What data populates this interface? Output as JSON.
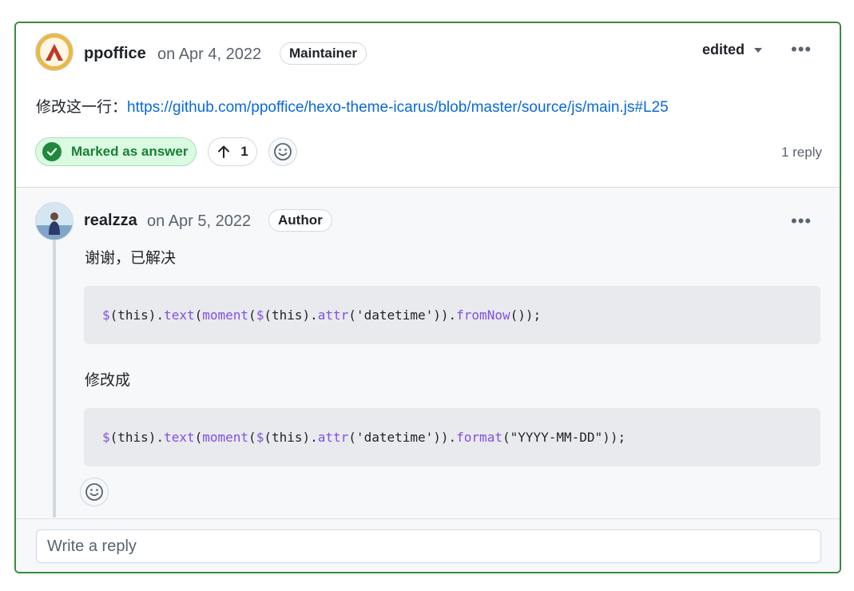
{
  "main_comment": {
    "author": "ppoffice",
    "date": "on Apr 4, 2022",
    "badge": "Maintainer",
    "edited_label": "edited",
    "body_prefix": "修改这一行：",
    "link_text": "https://github.com/ppoffice/hexo-theme-icarus/blob/master/source/js/main.js#L25",
    "answer_label": "Marked as answer",
    "upvote_count": "1",
    "reply_count": "1 reply",
    "more_label": "•••"
  },
  "reply": {
    "author": "realzza",
    "date": "on Apr 5, 2022",
    "badge": "Author",
    "text1": "谢谢，已解决",
    "code1": {
      "t1": "$",
      "t2": "(this).",
      "t3": "text",
      "t4": "(",
      "t5": "moment",
      "t6": "(",
      "t7": "$",
      "t8": "(this).",
      "t9": "attr",
      "t10": "('datetime')).",
      "t11": "fromNow",
      "t12": "());"
    },
    "text2": "修改成",
    "code2": {
      "t1": "$",
      "t2": "(this).",
      "t3": "text",
      "t4": "(",
      "t5": "moment",
      "t6": "(",
      "t7": "$",
      "t8": "(this).",
      "t9": "attr",
      "t10": "('datetime')).",
      "t11": "format",
      "t12": "(\"YYYY-MM-DD\"));"
    },
    "more_label": "•••"
  },
  "reply_input": {
    "placeholder": "Write a reply"
  },
  "colors": {
    "accent_border": "#3c8a3e",
    "answer_green": "#1a7f37",
    "link_blue": "#0969da",
    "code_purple": "#8250df"
  }
}
